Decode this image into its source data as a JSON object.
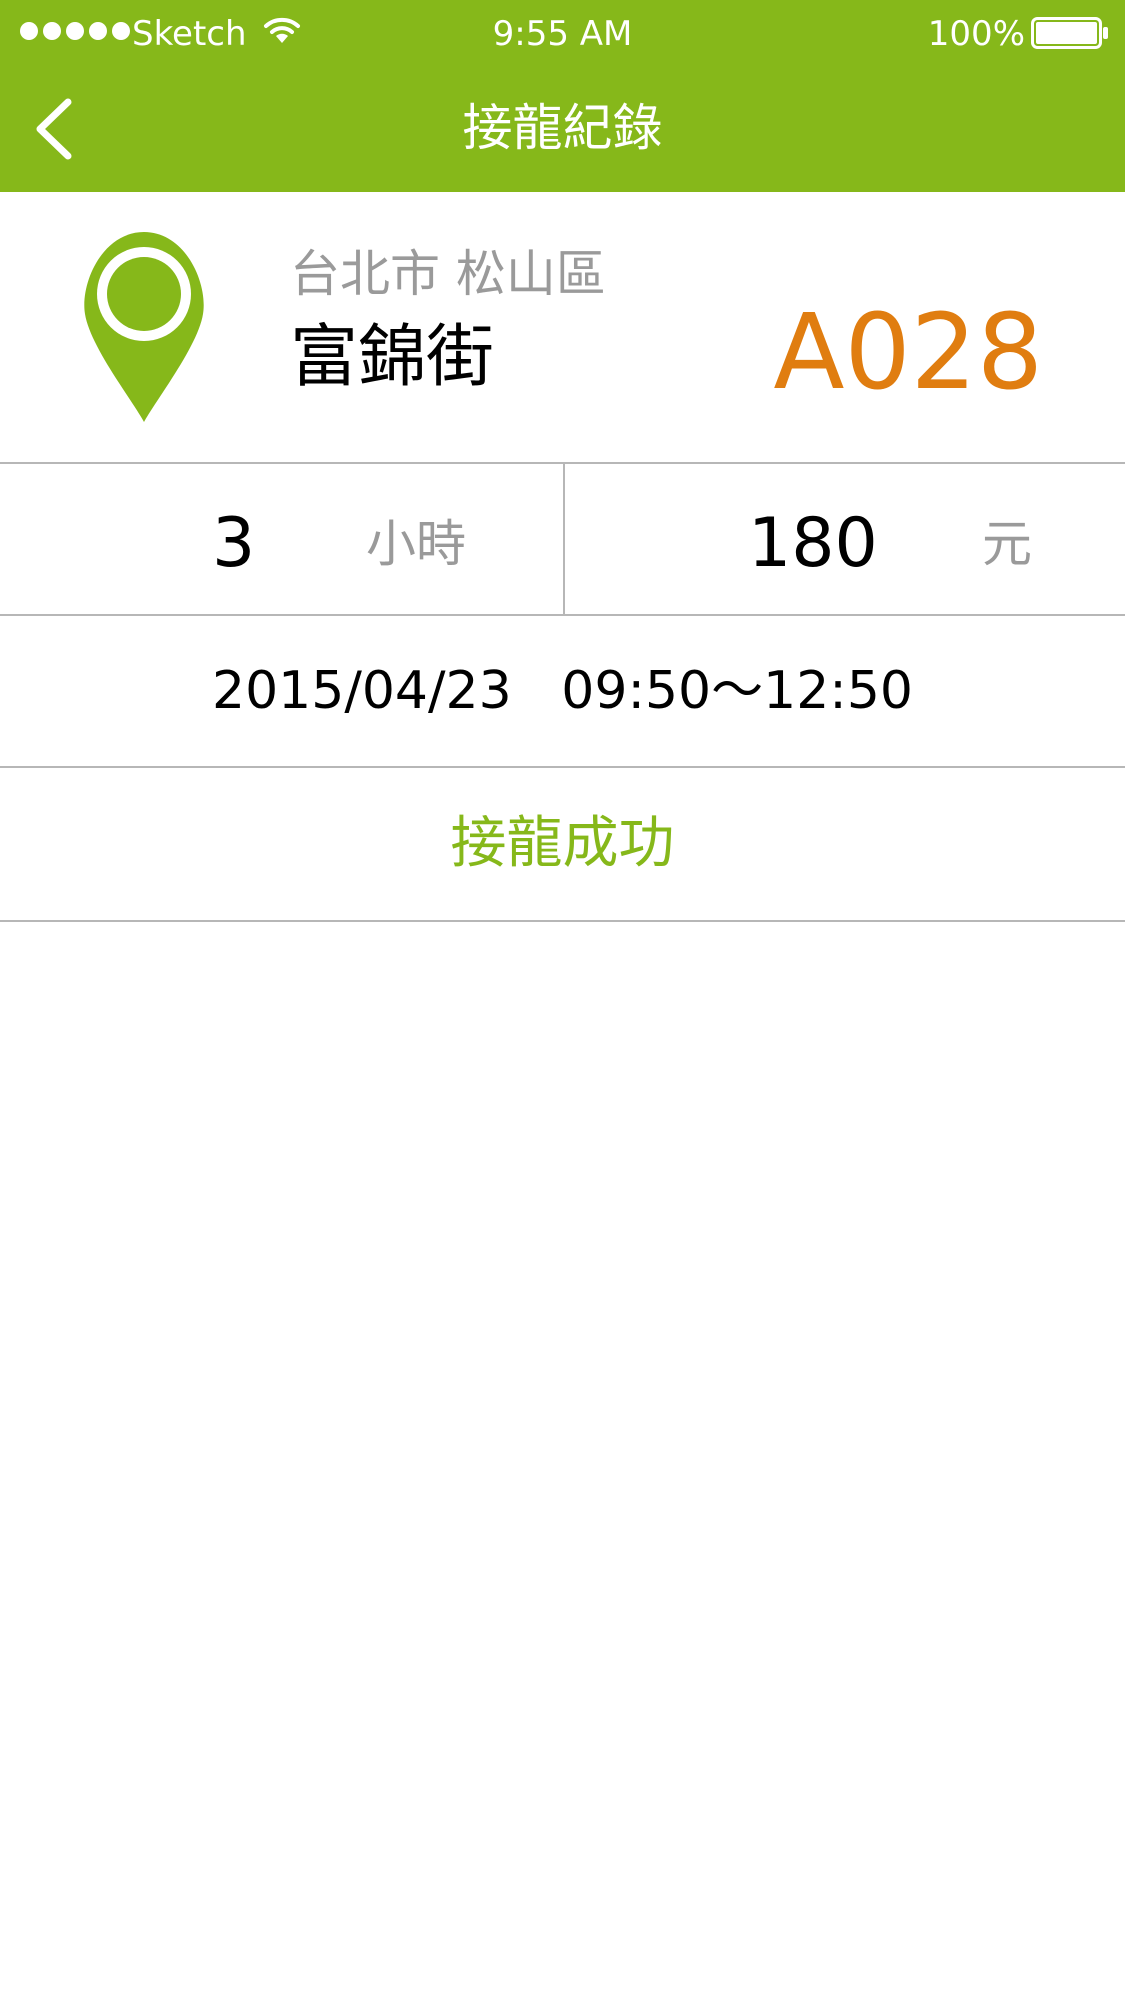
{
  "status_bar": {
    "carrier": "Sketch",
    "time": "9:55 AM",
    "battery_percent": "100%"
  },
  "nav": {
    "title": "接龍紀錄",
    "back_icon": "chevron-left-icon"
  },
  "location": {
    "pin_icon": "map-pin-icon",
    "district": "台北市 松山區",
    "street": "富錦街",
    "spot_code": "A028"
  },
  "stats": {
    "hours_value": "3",
    "hours_unit": "小時",
    "price_value": "180",
    "price_unit": "元"
  },
  "schedule": {
    "datetime": "2015/04/23   09:50～12:50"
  },
  "result": {
    "status": "接龍成功"
  },
  "colors": {
    "brand_green": "#86b81a",
    "accent_orange": "#e07d10",
    "muted_gray": "#9a9a9a",
    "divider": "#b7b7b7"
  }
}
